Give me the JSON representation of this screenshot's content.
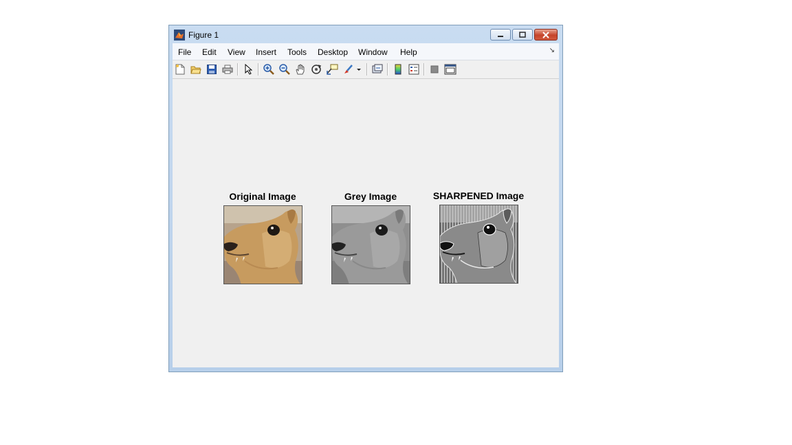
{
  "window": {
    "title": "Figure 1"
  },
  "menu": [
    "File",
    "Edit",
    "View",
    "Insert",
    "Tools",
    "Desktop",
    "Window",
    "Help"
  ],
  "toolbar_icons": [
    "new-figure-icon",
    "open-file-icon",
    "save-icon",
    "print-icon",
    "edit-plot-arrow-icon",
    "zoom-in-icon",
    "zoom-out-icon",
    "pan-hand-icon",
    "rotate-3d-icon",
    "data-cursor-icon",
    "brush-icon",
    "link-plot-icon",
    "colorbar-icon",
    "legend-icon",
    "hide-plot-tools-icon",
    "show-plot-tools-icon"
  ],
  "axes": [
    {
      "title": "Original Image"
    },
    {
      "title": "Grey Image"
    },
    {
      "title": "SHARPENED Image"
    }
  ],
  "colors": {
    "title_bar": "#c9dcf1",
    "client_bg": "#f0f0f0",
    "close_button": "#c5442a"
  }
}
